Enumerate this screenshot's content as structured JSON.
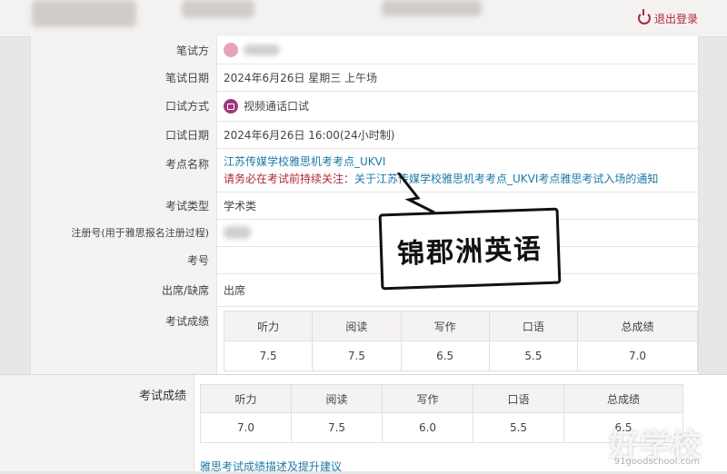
{
  "header": {
    "logout_label": "退出登录"
  },
  "rows": {
    "written_test": {
      "label": "笔试方",
      "value": ""
    },
    "written_date": {
      "label": "笔试日期",
      "value": "2024年6月26日 星期三 上午场"
    },
    "oral_mode": {
      "label": "口试方式",
      "value": "视频通话口试"
    },
    "oral_date": {
      "label": "口试日期",
      "value": "2024年6月26日 16:00(24小时制)"
    },
    "center": {
      "label": "考点名称",
      "value": "江苏传媒学校雅思机考考点_UKVI",
      "notice_prefix": "请务必在考试前持续关注：",
      "notice_link": "关于江苏传媒学校雅思机考考点_UKVI考点雅思考试入场的通知"
    },
    "exam_type": {
      "label": "考试类型",
      "value": "学术类"
    },
    "reg_no": {
      "label": "注册号(用于雅思报名注册过程)",
      "value": ""
    },
    "candidate_no": {
      "label": "考号",
      "value": ""
    },
    "attendance": {
      "label": "出席/缺席",
      "value": "出席"
    },
    "scores1": {
      "label": "考试成绩"
    }
  },
  "score_headers": [
    "听力",
    "阅读",
    "写作",
    "口语",
    "总成绩"
  ],
  "scores_first": [
    "7.5",
    "7.5",
    "6.5",
    "5.5",
    "7.0"
  ],
  "scores_second": [
    "7.0",
    "7.5",
    "6.0",
    "5.5",
    "6.5"
  ],
  "second_label": "考试成绩",
  "bottom_link": "雅思考试成绩描述及提升建议",
  "bubble_text": "锦郡洲英语",
  "watermark": "好学校",
  "watermark_url": "91goodschool.com"
}
